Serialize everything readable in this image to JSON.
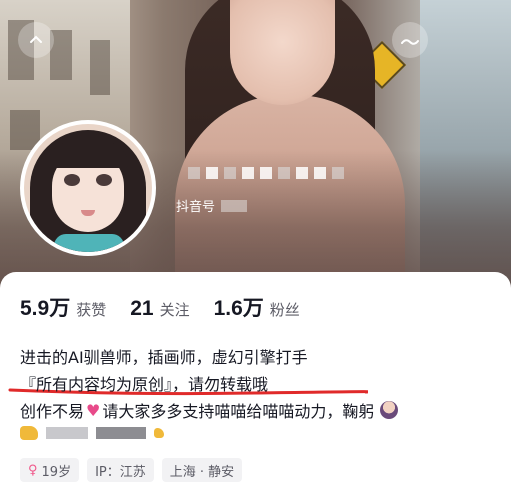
{
  "header": {
    "douyin_id_label": "抖音号",
    "back_icon": "chevron-icon",
    "more_icon": "tilde-icon"
  },
  "stats": [
    {
      "value": "5.9万",
      "label": "获赞"
    },
    {
      "value": "21",
      "label": "关注"
    },
    {
      "value": "1.6万",
      "label": "粉丝"
    }
  ],
  "bio": {
    "line1": "进击的AI驯兽师，插画师，虚幻引擎打手",
    "line2": "『所有内容均为原创』，请勿转载哦",
    "line3_a": "创作不易",
    "line3_b": "请大家多多支持喵喵给喵喵动力，鞠躬"
  },
  "tags": {
    "age": "19岁",
    "ip": "IP：江苏",
    "location": "上海 · 静安"
  },
  "colors": {
    "underline": "#e02a2a",
    "text": "#161823",
    "tag_bg": "#f2f2f4"
  }
}
